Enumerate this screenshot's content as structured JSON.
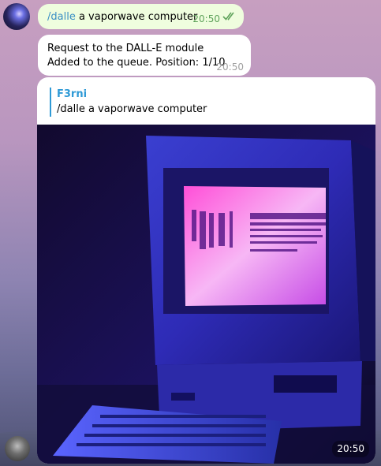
{
  "outgoing": {
    "command": "/dalle",
    "prompt": " a vaporwave computer",
    "time": "20:50"
  },
  "status": {
    "line1": "Request to the DALL-E module",
    "line2": "Added to the queue. Position: 1/10",
    "time": "20:50"
  },
  "reply": {
    "author": "F3rni",
    "quoted": "/dalle a vaporwave computer"
  },
  "photo": {
    "time": "20:50"
  },
  "colors": {
    "outgoing_bg": "#effdde",
    "accent": "#2f9ad6",
    "command": "#3a8fc5",
    "read_ticks": "#5fa35b"
  }
}
